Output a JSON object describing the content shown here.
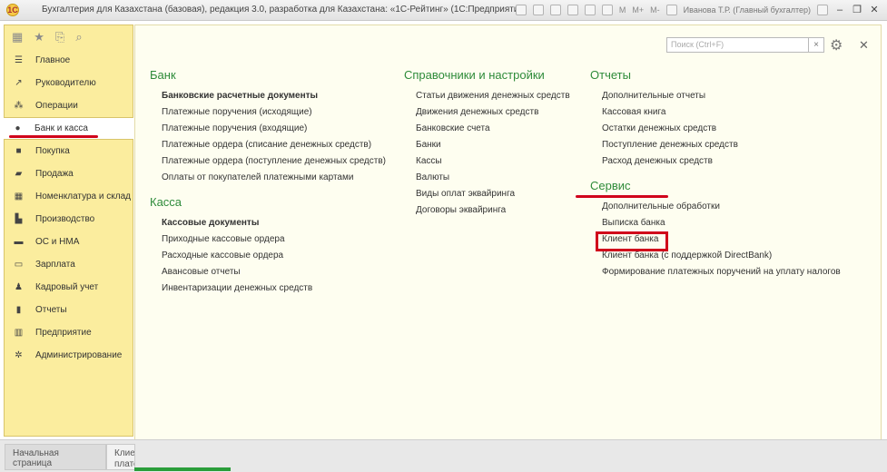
{
  "window": {
    "title": "Бухгалтерия для Казахстана (базовая), редакция 3.0, разработка для Казахстана: «1С-Рейтинг» (1С:Предприятие)",
    "memory_buttons": [
      "M",
      "M+",
      "M-"
    ],
    "user": "Иванова Т.Р. (Главный бухгалтер)",
    "minimize": "–",
    "restore": "❐",
    "close": "✕"
  },
  "sidebar": {
    "items": [
      {
        "label": "Главное",
        "icon": "menu-lines-icon"
      },
      {
        "label": "Руководителю",
        "icon": "trend-up-icon"
      },
      {
        "label": "Операции",
        "icon": "operations-icon"
      },
      {
        "label": "Банк и касса",
        "icon": "bank-coin-icon"
      },
      {
        "label": "Покупка",
        "icon": "cart-icon"
      },
      {
        "label": "Продажа",
        "icon": "shopping-bag-icon"
      },
      {
        "label": "Номенклатура и склад",
        "icon": "grid-blocks-icon"
      },
      {
        "label": "Производство",
        "icon": "factory-icon"
      },
      {
        "label": "ОС и НМА",
        "icon": "truck-icon"
      },
      {
        "label": "Зарплата",
        "icon": "wallet-icon"
      },
      {
        "label": "Кадровый учет",
        "icon": "people-icon"
      },
      {
        "label": "Отчеты",
        "icon": "bar-chart-icon"
      },
      {
        "label": "Предприятие",
        "icon": "building-icon"
      },
      {
        "label": "Администрирование",
        "icon": "gear-icon"
      }
    ],
    "active_index": 3
  },
  "search": {
    "placeholder": "Поиск (Ctrl+F)",
    "clear": "×"
  },
  "sections": {
    "bank": {
      "title": "Банк",
      "links": [
        "Банковские расчетные документы",
        "Платежные поручения (исходящие)",
        "Платежные поручения (входящие)",
        "Платежные ордера (списание денежных средств)",
        "Платежные ордера (поступление денежных средств)",
        "Оплаты от покупателей платежными картами"
      ]
    },
    "kassa": {
      "title": "Касса",
      "links": [
        "Кассовые документы",
        "Приходные кассовые ордера",
        "Расходные кассовые ордера",
        "Авансовые отчеты",
        "Инвентаризации денежных средств"
      ]
    },
    "spravochniki": {
      "title": "Справочники и настройки",
      "links": [
        "Статьи движения денежных средств",
        "Движения денежных средств",
        "Банковские счета",
        "Банки",
        "Кассы",
        "Валюты",
        "Виды оплат эквайринга",
        "Договоры эквайринга"
      ]
    },
    "otchety": {
      "title": "Отчеты",
      "links": [
        "Дополнительные отчеты",
        "Кассовая книга",
        "Остатки денежных средств",
        "Поступление денежных средств",
        "Расход денежных средств"
      ]
    },
    "servis": {
      "title": "Сервис",
      "links": [
        "Дополнительные обработки",
        "Выписка банка",
        "Клиент банка",
        "Клиент банка (с поддержкой DirectBank)",
        "Формирование платежных поручений на уплату налогов"
      ]
    }
  },
  "bottom_tabs": [
    "Начальная страница",
    "Клиен плате"
  ],
  "colors": {
    "sidebar_bg": "#fbed9e",
    "section_title": "#2e8b3a",
    "highlight_red": "#d0021b",
    "tab_accent": "#2a9d3a"
  }
}
